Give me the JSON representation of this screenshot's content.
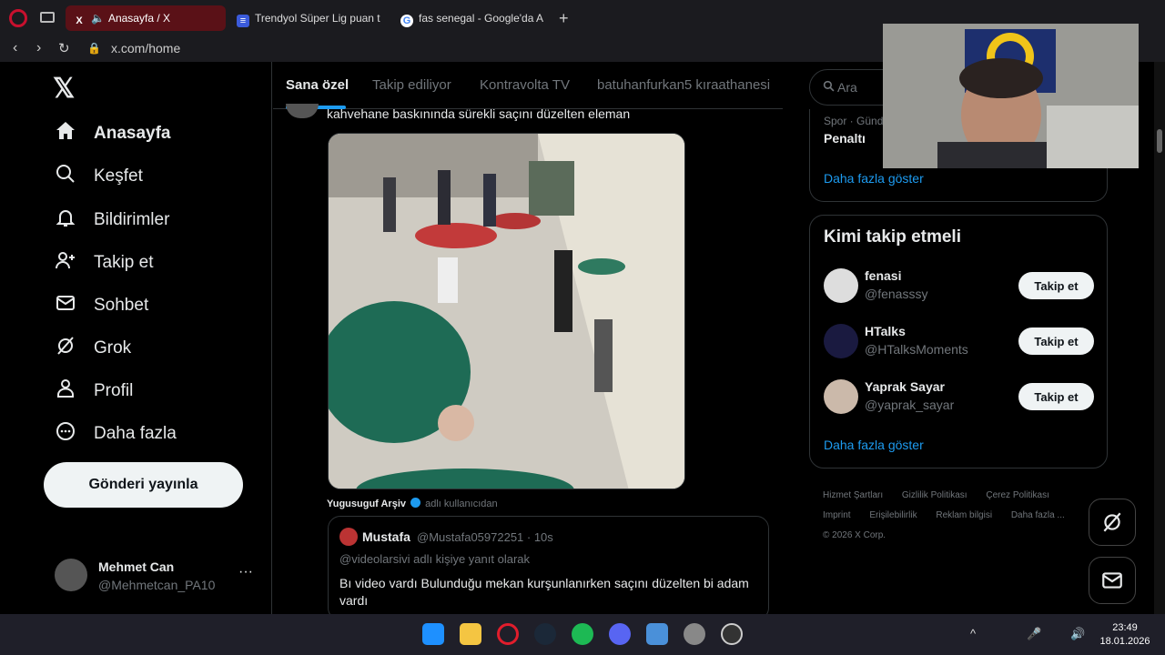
{
  "browser": {
    "tabs": [
      {
        "label": "Anasayfa / X"
      },
      {
        "label": "Trendyol Süper Lig puan t"
      },
      {
        "label": "fas senegal - Google'da A"
      }
    ],
    "new_tab": "+",
    "url": "x.com/home"
  },
  "leftnav": {
    "logo": "𝕏",
    "items": [
      {
        "label": "Anasayfa",
        "icon": "home-icon"
      },
      {
        "label": "Keşfet",
        "icon": "search-icon"
      },
      {
        "label": "Bildirimler",
        "icon": "bell-icon"
      },
      {
        "label": "Takip et",
        "icon": "follow-icon"
      },
      {
        "label": "Sohbet",
        "icon": "mail-icon"
      },
      {
        "label": "Grok",
        "icon": "grok-icon"
      },
      {
        "label": "Profil",
        "icon": "person-icon"
      },
      {
        "label": "Daha fazla",
        "icon": "more-icon"
      }
    ],
    "post_button": "Gönderi yayınla",
    "account": {
      "name": "Mehmet Can",
      "handle": "@Mehmetcan_PA10",
      "more": "···"
    }
  },
  "timeline": {
    "tabs": [
      "Sana özel",
      "Takip ediliyor",
      "Kontravolta TV",
      "batuhanfurkan5 kıraathanesi"
    ],
    "tweet_text": "kahvehane baskınında sürekli saçını düzelten eleman",
    "credit_name": "Yugusuguf Arşiv",
    "credit_suffix": "adlı kullanıcıdan",
    "quote": {
      "name": "Mustafa",
      "handle": "@Mustafa05972251 · 10s",
      "reply": "@videolarsivi adlı kişiye yanıt olarak",
      "body": "Bı video vardı Bulunduğu mekan kurşunlanırken saçını düzelten bi adam vardı"
    }
  },
  "right": {
    "search_placeholder": "Ara",
    "trend": {
      "meta": "Spor · Günd",
      "name": "Penaltı",
      "more": "Daha fazla göster"
    },
    "who_to_follow": {
      "title": "Kimi takip etmeli",
      "users": [
        {
          "name": "fenasi",
          "handle": "@fenasssy",
          "button": "Takip et"
        },
        {
          "name": "HTalks",
          "handle": "@HTalksMoments",
          "button": "Takip et"
        },
        {
          "name": "Yaprak Sayar",
          "handle": "@yaprak_sayar",
          "button": "Takip et"
        }
      ],
      "more": "Daha fazla göster"
    },
    "footer": [
      "Hizmet Şartları",
      "Gizlilik Politikası",
      "Çerez Politikası",
      "Imprint",
      "Erişilebilirlik",
      "Reklam bilgisi",
      "Daha fazla ...",
      "© 2026 X Corp."
    ]
  },
  "taskbar": {
    "time": "23:49",
    "date": "18.01.2026"
  }
}
